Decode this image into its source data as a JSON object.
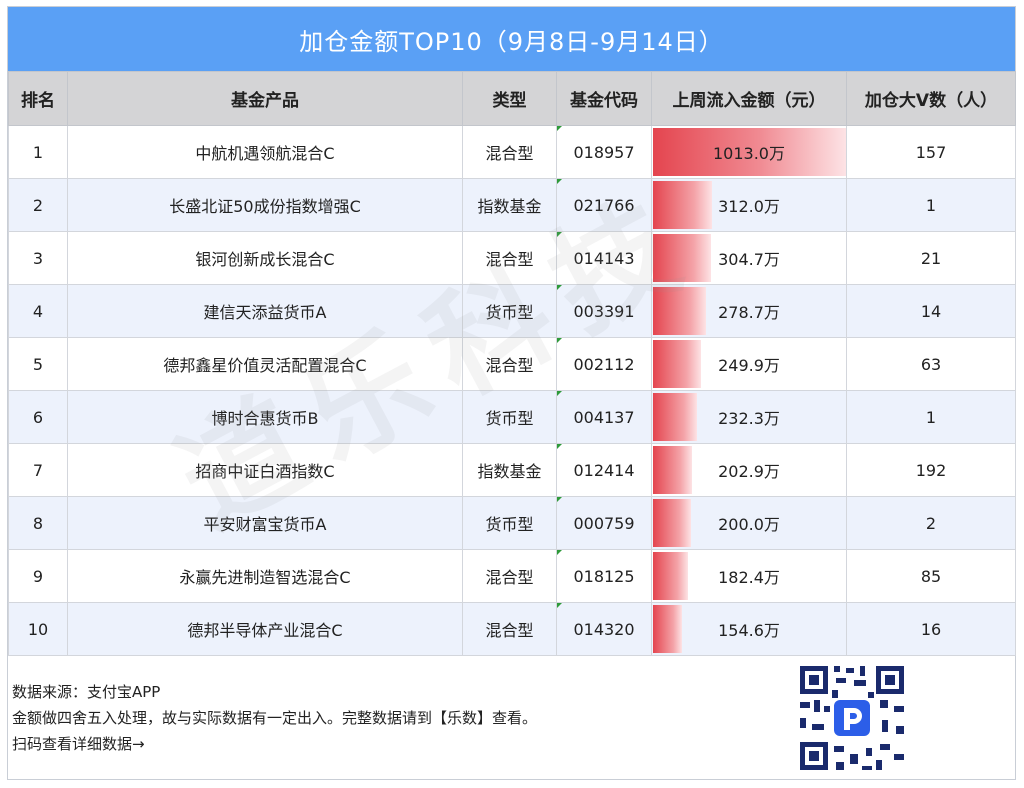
{
  "title": "加仓金额TOP10（9月8日-9月14日）",
  "watermark": "道乐科技",
  "headers": {
    "rank": "排名",
    "product": "基金产品",
    "type": "类型",
    "code": "基金代码",
    "amount": "上周流入金额（元）",
    "users": "加仓大V数（人）"
  },
  "chart_data": {
    "type": "table",
    "columns": [
      "排名",
      "基金产品",
      "类型",
      "基金代码",
      "上周流入金额（元）",
      "加仓大V数（人）"
    ],
    "rows": [
      {
        "rank": "1",
        "product": "中航机遇领航混合C",
        "type": "混合型",
        "code": "018957",
        "amount": 1013.0,
        "amount_label": "1013.0万",
        "users": "157"
      },
      {
        "rank": "2",
        "product": "长盛北证50成份指数增强C",
        "type": "指数基金",
        "code": "021766",
        "amount": 312.0,
        "amount_label": "312.0万",
        "users": "1"
      },
      {
        "rank": "3",
        "product": "银河创新成长混合C",
        "type": "混合型",
        "code": "014143",
        "amount": 304.7,
        "amount_label": "304.7万",
        "users": "21"
      },
      {
        "rank": "4",
        "product": "建信天添益货币A",
        "type": "货币型",
        "code": "003391",
        "amount": 278.7,
        "amount_label": "278.7万",
        "users": "14"
      },
      {
        "rank": "5",
        "product": "德邦鑫星价值灵活配置混合C",
        "type": "混合型",
        "code": "002112",
        "amount": 249.9,
        "amount_label": "249.9万",
        "users": "63"
      },
      {
        "rank": "6",
        "product": "博时合惠货币B",
        "type": "货币型",
        "code": "004137",
        "amount": 232.3,
        "amount_label": "232.3万",
        "users": "1"
      },
      {
        "rank": "7",
        "product": "招商中证白酒指数C",
        "type": "指数基金",
        "code": "012414",
        "amount": 202.9,
        "amount_label": "202.9万",
        "users": "192"
      },
      {
        "rank": "8",
        "product": "平安财富宝货币A",
        "type": "货币型",
        "code": "000759",
        "amount": 200.0,
        "amount_label": "200.0万",
        "users": "2"
      },
      {
        "rank": "9",
        "product": "永赢先进制造智选混合C",
        "type": "混合型",
        "code": "018125",
        "amount": 182.4,
        "amount_label": "182.4万",
        "users": "85"
      },
      {
        "rank": "10",
        "product": "德邦半导体产业混合C",
        "type": "混合型",
        "code": "014320",
        "amount": 154.6,
        "amount_label": "154.6万",
        "users": "16"
      }
    ]
  },
  "footer": {
    "line1": "数据来源：支付宝APP",
    "line2": "金额做四舍五入处理，故与实际数据有一定出入。完整数据请到【乐数】查看。",
    "line3": "扫码查看详细数据→"
  },
  "colors": {
    "title_bg": "#5aa0f5",
    "header_bg": "#d4d4d6",
    "alt_row_bg": "#edf2fc",
    "bar": "#e4454f"
  }
}
